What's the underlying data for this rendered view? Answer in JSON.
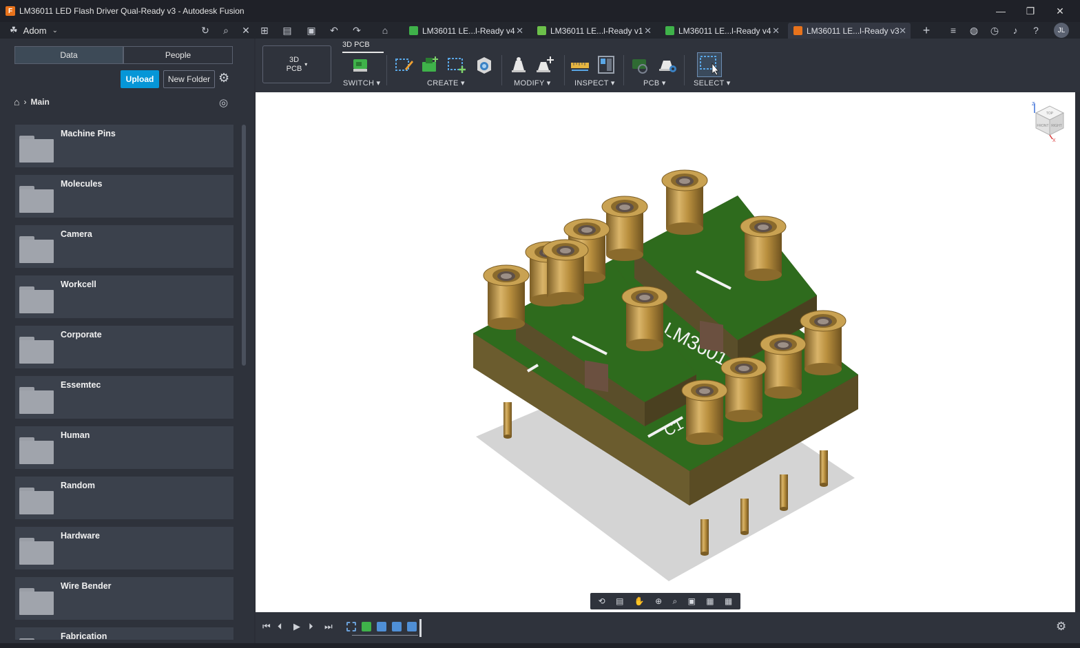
{
  "window": {
    "title": "LM36011 LED Flash Driver Qual-Ready v3 - Autodesk Fusion",
    "app_icon": "F",
    "minimize": "—",
    "restore": "❐",
    "close": "✕"
  },
  "topbar": {
    "team_name": "Adom",
    "team_icon": "☘",
    "chevron": "⌄",
    "tabs": [
      {
        "label": "LM36011 LE...l-Ready v4",
        "color": "#3fb24a",
        "close": "✕"
      },
      {
        "label": "LM36011 LE...l-Ready v1",
        "color": "#6cc04a",
        "close": "✕"
      },
      {
        "label": "LM36011 LE...l-Ready v4",
        "color": "#3fb24a",
        "close": "✕"
      },
      {
        "label": "LM36011 LE...l-Ready v3",
        "color": "#e8731c",
        "close": "✕"
      }
    ],
    "avatar": "JL",
    "icons": {
      "refresh": "↻",
      "search": "⌕",
      "close": "✕",
      "grid": "⊞",
      "file": "▤",
      "save": "▣",
      "undo": "↶",
      "redo": "↷",
      "home": "⌂",
      "add": "+",
      "extensions": "≡",
      "network": "◍",
      "history": "◷",
      "bell": "♪",
      "help": "?"
    }
  },
  "datapanel": {
    "tabs": [
      "Data",
      "People"
    ],
    "upload": "Upload",
    "new_folder": "New Folder",
    "gear": "⚙",
    "breadcrumb": {
      "home": "⌂",
      "sep": "›",
      "current": "Main"
    },
    "globe": "◎",
    "folders": [
      "Machine Pins",
      "Molecules",
      "Camera",
      "Workcell",
      "Corporate",
      "Essemtec",
      "Human",
      "Random",
      "Hardware",
      "Wire Bender",
      "Fabrication"
    ]
  },
  "toolbar": {
    "workspace_line1": "3D",
    "workspace_line2": "PCB",
    "workspace_dropdown": "▾",
    "active_tab": "3D PCB",
    "groups": {
      "switch": "SWITCH ▾",
      "create": "CREATE ▾",
      "modify": "MODIFY ▾",
      "inspect": "INSPECT ▾",
      "pcb": "PCB ▾",
      "select": "SELECT ▾"
    }
  },
  "viewcube": {
    "top": "TOP",
    "front": "FRONT",
    "right": "RIGHT",
    "axis_z": "Z",
    "axis_x": "X"
  },
  "pcb": {
    "silkscreen": "LM3601",
    "ref": "C1"
  },
  "navbar": {
    "orbit": "⟲",
    "look": "▤",
    "pan": "✋",
    "zoom": "⊕",
    "fit": "⌕",
    "display": "▣",
    "grid": "▦",
    "viewports": "▦",
    "dd": "▾"
  },
  "timeline": {
    "first": "⏮",
    "prev": "⏴",
    "play": "▶",
    "next": "⏵",
    "last": "⏭",
    "gear": "⚙",
    "features": [
      "#6aa0d8",
      "#3fb24a",
      "#4f8fd6",
      "#4f8fd6",
      "#4f8fd6"
    ]
  },
  "colors": {
    "accent": "#0696d7",
    "pcb_green": "#2e6b1d",
    "brass": "#b8923f"
  }
}
